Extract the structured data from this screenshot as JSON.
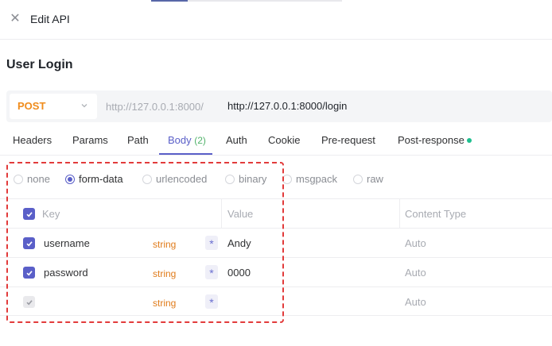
{
  "header": {
    "title": "Edit API",
    "close_icon": "close-icon"
  },
  "page": {
    "title": "User Login"
  },
  "request": {
    "method": "POST",
    "base_url": "http://127.0.0.1:8000/",
    "full_url": "http://127.0.0.1:8000/login"
  },
  "tabs": [
    {
      "label": "Headers"
    },
    {
      "label": "Params"
    },
    {
      "label": "Path"
    },
    {
      "label": "Body",
      "count": "(2)",
      "active": true
    },
    {
      "label": "Auth"
    },
    {
      "label": "Cookie"
    },
    {
      "label": "Pre-request"
    },
    {
      "label": "Post-response",
      "indicator": "dot"
    }
  ],
  "body_types": [
    {
      "label": "none",
      "checked": false
    },
    {
      "label": "form-data",
      "checked": true
    },
    {
      "label": "urlencoded",
      "checked": false
    },
    {
      "label": "binary",
      "checked": false
    },
    {
      "label": "msgpack",
      "checked": false
    },
    {
      "label": "raw",
      "checked": false
    }
  ],
  "table": {
    "headers": {
      "key": "Key",
      "value": "Value",
      "content_type": "Content Type"
    },
    "rows": [
      {
        "key": "username",
        "type": "string",
        "required_mark": "*",
        "value": "Andy",
        "content_type": "Auto"
      },
      {
        "key": "password",
        "type": "string",
        "required_mark": "*",
        "value": "0000",
        "content_type": "Auto"
      },
      {
        "key": "",
        "type": "string",
        "required_mark": "*",
        "value": "",
        "content_type": "Auto"
      }
    ]
  },
  "colors": {
    "accent": "#5a5fc8",
    "method": "#f08c1c",
    "type": "#e07b1a",
    "highlight": "#e23b3b",
    "status_dot": "#1fbf8f"
  }
}
